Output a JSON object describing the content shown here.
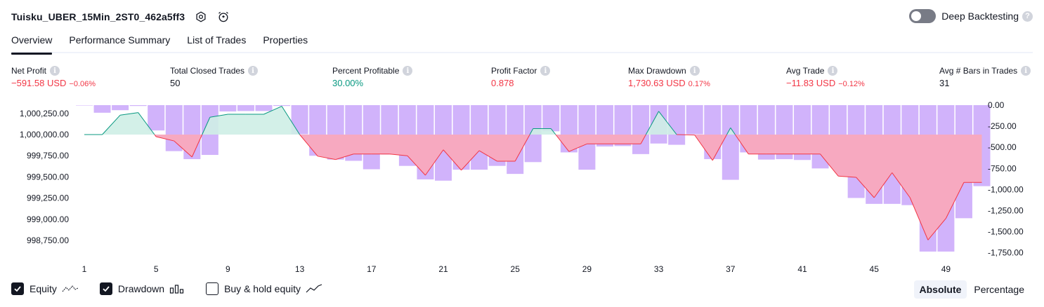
{
  "header": {
    "title": "Tuisku_UBER_15Min_2ST0_462a5ff3",
    "deep_backtesting_label": "Deep Backtesting",
    "deep_backtesting_enabled": false,
    "help_glyph": "?"
  },
  "tabs": [
    {
      "label": "Overview",
      "active": true
    },
    {
      "label": "Performance Summary",
      "active": false
    },
    {
      "label": "List of Trades",
      "active": false
    },
    {
      "label": "Properties",
      "active": false
    }
  ],
  "metrics": {
    "net_profit": {
      "label": "Net Profit",
      "value": "−591.58 USD",
      "pct": "−0.06%"
    },
    "total_closed_trades": {
      "label": "Total Closed Trades",
      "value": "50"
    },
    "percent_profitable": {
      "label": "Percent Profitable",
      "value": "30.00%"
    },
    "profit_factor": {
      "label": "Profit Factor",
      "value": "0.878"
    },
    "max_drawdown": {
      "label": "Max Drawdown",
      "value": "1,730.63 USD",
      "pct": "0.17%"
    },
    "avg_trade": {
      "label": "Avg Trade",
      "value": "−11.83 USD",
      "pct": "−0.12%"
    },
    "avg_bars": {
      "label": "Avg # Bars in Trades",
      "value": "31"
    }
  },
  "info_glyph": "i",
  "chart_data": {
    "type": "bar+area",
    "x_ticks": [
      1,
      5,
      9,
      13,
      17,
      21,
      25,
      29,
      33,
      37,
      41,
      45,
      49
    ],
    "left_axis": {
      "ticks": [
        "1,000,250.00",
        "1,000,000.00",
        "999,750.00",
        "999,500.00",
        "999,250.00",
        "999,000.00",
        "998,750.00"
      ],
      "range": [
        998650,
        1000350
      ]
    },
    "right_axis": {
      "ticks": [
        "0.00",
        "-250.00",
        "-500.00",
        "-750.00",
        "-1,000.00",
        "-1,250.00",
        "-1,500.00",
        "-1,750.00"
      ],
      "range": [
        -1750,
        0
      ]
    },
    "series": [
      {
        "name": "Equity",
        "x": [
          1,
          2,
          3,
          4,
          5,
          6,
          7,
          8,
          9,
          10,
          11,
          12,
          13,
          14,
          15,
          16,
          17,
          18,
          19,
          20,
          21,
          22,
          23,
          24,
          25,
          26,
          27,
          28,
          29,
          30,
          31,
          32,
          33,
          34,
          35,
          36,
          37,
          38,
          39,
          40,
          41,
          42,
          43,
          44,
          45,
          46,
          47,
          48,
          49,
          50,
          51
        ],
        "values": [
          1000000,
          1000000,
          1000230,
          1000260,
          999975,
          999925,
          999735,
          1000205,
          1000240,
          1000240,
          1000240,
          1000335,
          1000000,
          999745,
          999705,
          999770,
          999770,
          999770,
          999750,
          999520,
          999820,
          999580,
          999810,
          999685,
          999685,
          1000070,
          1000070,
          999800,
          999890,
          999890,
          999890,
          999890,
          1000275,
          1000000,
          999995,
          999695,
          1000080,
          999770,
          999770,
          999770,
          999770,
          999770,
          999510,
          999495,
          999255,
          999550,
          999255,
          998755,
          999010,
          999435,
          999435
        ],
        "colors": {
          "positive": "#089981",
          "negative": "#f23645",
          "fill_positive": "#ceeee5",
          "fill_negative": "#f7a9c0"
        }
      },
      {
        "name": "Drawdown",
        "x": [
          1,
          2,
          3,
          4,
          5,
          6,
          7,
          8,
          9,
          10,
          11,
          12,
          13,
          14,
          15,
          16,
          17,
          18,
          19,
          20,
          21,
          22,
          23,
          24,
          25,
          26,
          27,
          28,
          29,
          30,
          31,
          32,
          33,
          34,
          35,
          36,
          37,
          38,
          39,
          40,
          41,
          42,
          43,
          44,
          45,
          46,
          47,
          48,
          49,
          50,
          51
        ],
        "values": [
          0,
          -90,
          -60,
          -10,
          -300,
          -545,
          -640,
          -590,
          -75,
          -70,
          -70,
          -10,
          -345,
          -600,
          -645,
          -660,
          -760,
          -585,
          -720,
          -880,
          -895,
          -765,
          -765,
          -720,
          -815,
          -675,
          -310,
          -560,
          -765,
          -490,
          -485,
          -580,
          -455,
          -470,
          -345,
          -640,
          -885,
          -560,
          -645,
          -640,
          -650,
          -750,
          -560,
          -1100,
          -1170,
          -1170,
          -1185,
          -1735,
          -1735,
          -1340,
          -960
        ],
        "color": "#d1b3fb"
      }
    ]
  },
  "controls": {
    "equity": {
      "label": "Equity",
      "checked": true
    },
    "drawdown": {
      "label": "Drawdown",
      "checked": true
    },
    "buy_hold": {
      "label": "Buy & hold equity",
      "checked": false
    }
  },
  "mode": {
    "absolute": "Absolute",
    "percentage": "Percentage",
    "active": "absolute"
  }
}
